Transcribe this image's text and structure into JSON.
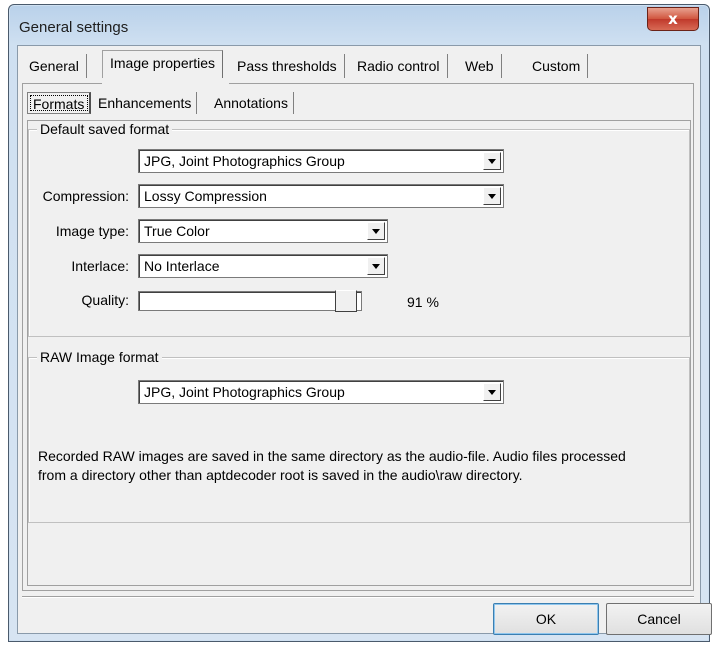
{
  "window": {
    "title": "General settings",
    "close_label": "x"
  },
  "tabs": [
    {
      "label": "General",
      "active": false
    },
    {
      "label": "Image properties",
      "active": true
    },
    {
      "label": "Pass thresholds",
      "active": false
    },
    {
      "label": "Radio control",
      "active": false
    },
    {
      "label": "Web",
      "active": false
    },
    {
      "label": "Custom",
      "active": false
    }
  ],
  "subtabs": [
    {
      "label": "Formats",
      "active": true
    },
    {
      "label": "Enhancements",
      "active": false
    },
    {
      "label": "Annotations",
      "active": false
    }
  ],
  "default_format": {
    "legend": "Default saved format",
    "format_value": "JPG, Joint Photographics Group",
    "compression_label": "Compression:",
    "compression_value": "Lossy Compression",
    "image_type_label": "Image type:",
    "image_type_value": "True Color",
    "interlace_label": "Interlace:",
    "interlace_value": "No Interlace",
    "quality_label": "Quality:",
    "quality_value": 91,
    "quality_text": "91 %"
  },
  "raw_format": {
    "legend": "RAW Image format",
    "format_value": "JPG, Joint Photographics Group",
    "note_line1": "Recorded RAW images are saved in the same directory as the audio-file. Audio files processed",
    "note_line2": "from a directory other than aptdecoder root is saved in the audio\\raw directory."
  },
  "buttons": {
    "ok": "OK",
    "cancel": "Cancel"
  }
}
